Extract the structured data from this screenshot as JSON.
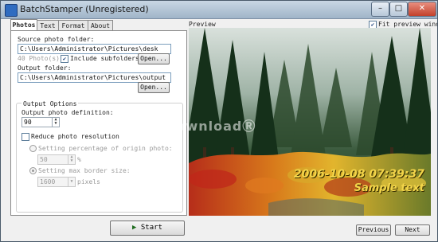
{
  "window": {
    "title": "BatchStamper (Unregistered)",
    "minimize": "–",
    "maximize": "□",
    "close": "✕"
  },
  "tabs": [
    {
      "label": "Photos",
      "active": true
    },
    {
      "label": "Text",
      "active": false
    },
    {
      "label": "Format",
      "active": false
    },
    {
      "label": "About",
      "active": false
    }
  ],
  "photos": {
    "source_label": "Source photo folder:",
    "source_value": "C:\\Users\\Administrator\\Pictures\\desk",
    "photo_count": "40 Photo(s)",
    "include_subfolders_label": "Include subfolders",
    "include_subfolders_checked": true,
    "open_label": "Open...",
    "output_label": "Output folder:",
    "output_value": "C:\\Users\\Administrator\\Pictures\\output",
    "output_open_label": "Open...",
    "options_title": "Output Options",
    "definition_label": "Output photo definition:",
    "definition_value": "90",
    "reduce_label": "Reduce photo resolution",
    "reduce_checked": false,
    "percentage_label": "Setting percentage of origin photo:",
    "percentage_value": "50",
    "percentage_unit": "%",
    "border_label": "Setting max border size:",
    "border_value": "1600",
    "border_unit": "pixels"
  },
  "actions": {
    "start_label": "Start"
  },
  "preview": {
    "label": "Preview",
    "fit_label": "Fit preview window",
    "fit_checked": true,
    "watermark": "downloadⓇ",
    "stamp_date": "2006-10-08 07:39:37",
    "stamp_text": "Sample text",
    "previous_label": "Previous",
    "next_label": "Next"
  }
}
